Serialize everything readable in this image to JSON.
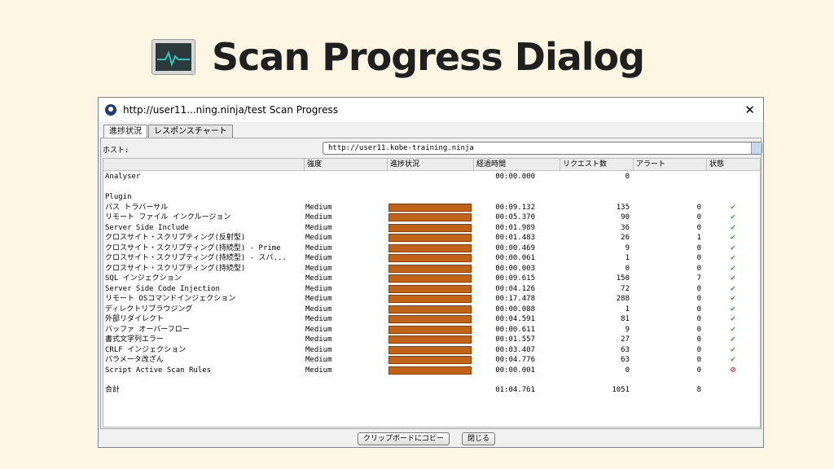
{
  "slide": {
    "title": "Scan Progress Dialog",
    "icon": "activity-monitor-icon"
  },
  "window": {
    "title": "http://user11...ning.ninja/test Scan Progress",
    "tabs": [
      {
        "label": "進捗状況",
        "active": true
      },
      {
        "label": "レスポンスチャート",
        "active": false
      }
    ],
    "host_label": "ホスト:",
    "host_value": "http://user11.kobe-training.ninja",
    "columns": {
      "name": "",
      "strength": "強度",
      "progress": "進捗状況",
      "elapsed": "経過時間",
      "requests": "リクエスト数",
      "alerts": "アラート",
      "status": "状態"
    },
    "analyser": {
      "name": "Analyser",
      "elapsed": "00:00.000",
      "requests": "0"
    },
    "plugin_header": "Plugin",
    "plugins": [
      {
        "name": "パス トラバーサル",
        "strength": "Medium",
        "progress": 100,
        "elapsed": "00:09.132",
        "requests": "135",
        "alerts": "0",
        "status": "ok"
      },
      {
        "name": "リモート ファイル インクルージョン",
        "strength": "Medium",
        "progress": 100,
        "elapsed": "00:05.370",
        "requests": "90",
        "alerts": "0",
        "status": "ok"
      },
      {
        "name": "Server Side Include",
        "strength": "Medium",
        "progress": 100,
        "elapsed": "00:01.989",
        "requests": "36",
        "alerts": "0",
        "status": "ok"
      },
      {
        "name": "クロスサイト・スクリプティング(反射型)",
        "strength": "Medium",
        "progress": 100,
        "elapsed": "00:01.483",
        "requests": "26",
        "alerts": "1",
        "status": "ok"
      },
      {
        "name": "クロスサイト・スクリプティング(持続型) - Prime",
        "strength": "Medium",
        "progress": 100,
        "elapsed": "00:00.469",
        "requests": "9",
        "alerts": "0",
        "status": "ok"
      },
      {
        "name": "クロスサイト・スクリプティング(持続型) - スパ...",
        "strength": "Medium",
        "progress": 100,
        "elapsed": "00:00.061",
        "requests": "1",
        "alerts": "0",
        "status": "ok"
      },
      {
        "name": "クロスサイト・スクリプティング(持続型)",
        "strength": "Medium",
        "progress": 100,
        "elapsed": "00:00.003",
        "requests": "0",
        "alerts": "0",
        "status": "ok"
      },
      {
        "name": "SQL インジェクション",
        "strength": "Medium",
        "progress": 100,
        "elapsed": "00:09.615",
        "requests": "150",
        "alerts": "7",
        "status": "ok"
      },
      {
        "name": "Server Side Code Injection",
        "strength": "Medium",
        "progress": 100,
        "elapsed": "00:04.126",
        "requests": "72",
        "alerts": "0",
        "status": "ok"
      },
      {
        "name": "リモート OSコマンドインジェクション",
        "strength": "Medium",
        "progress": 100,
        "elapsed": "00:17.478",
        "requests": "288",
        "alerts": "0",
        "status": "ok"
      },
      {
        "name": "ディレクトリブラウジング",
        "strength": "Medium",
        "progress": 100,
        "elapsed": "00:00.088",
        "requests": "1",
        "alerts": "0",
        "status": "ok"
      },
      {
        "name": "外部リダイレクト",
        "strength": "Medium",
        "progress": 100,
        "elapsed": "00:04.591",
        "requests": "81",
        "alerts": "0",
        "status": "ok"
      },
      {
        "name": "バッファ オーバーフロー",
        "strength": "Medium",
        "progress": 100,
        "elapsed": "00:00.611",
        "requests": "9",
        "alerts": "0",
        "status": "ok"
      },
      {
        "name": "書式文字列エラー",
        "strength": "Medium",
        "progress": 100,
        "elapsed": "00:01.557",
        "requests": "27",
        "alerts": "0",
        "status": "ok"
      },
      {
        "name": "CRLF インジェクション",
        "strength": "Medium",
        "progress": 100,
        "elapsed": "00:03.407",
        "requests": "63",
        "alerts": "0",
        "status": "ok"
      },
      {
        "name": "パラメータ改ざん",
        "strength": "Medium",
        "progress": 100,
        "elapsed": "00:04.776",
        "requests": "63",
        "alerts": "0",
        "status": "ok"
      },
      {
        "name": "Script Active Scan Rules",
        "strength": "Medium",
        "progress": 100,
        "elapsed": "00:00.001",
        "requests": "0",
        "alerts": "0",
        "status": "skipped"
      }
    ],
    "total": {
      "name": "合計",
      "elapsed": "01:04.761",
      "requests": "1051",
      "alerts": "8"
    },
    "buttons": {
      "copy": "クリップボードにコピー",
      "close": "閉じる"
    },
    "close_icon": "close-icon",
    "colors": {
      "progress": "#c26216",
      "ok": "#2ea82e",
      "skipped": "#d62020"
    }
  }
}
